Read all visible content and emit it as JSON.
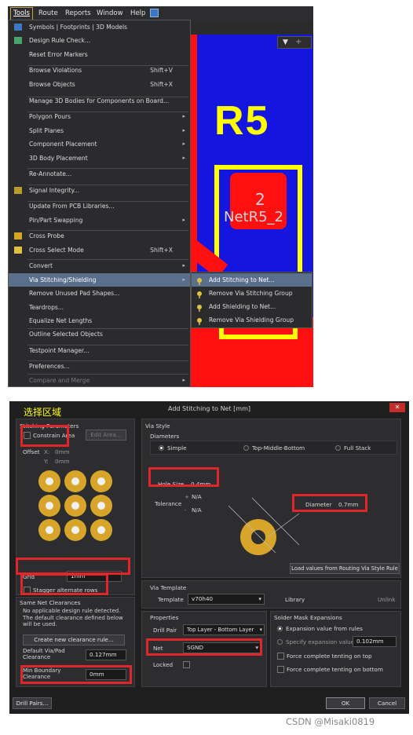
{
  "menubar": [
    "Tools",
    "Route",
    "Reports",
    "Window",
    "Help"
  ],
  "tools_menu": {
    "items": [
      {
        "label": "Symbols | Footprints | 3D Models",
        "shortcut": "",
        "arrow": false
      },
      {
        "label": "Design Rule Check...",
        "shortcut": "",
        "arrow": false
      },
      {
        "label": "Reset Error Markers",
        "shortcut": "",
        "arrow": false
      },
      {
        "label": "Browse Violations",
        "shortcut": "Shift+V",
        "arrow": false
      },
      {
        "label": "Browse Objects",
        "shortcut": "Shift+X",
        "arrow": false
      },
      {
        "label": "Manage 3D Bodies for Components on Board...",
        "shortcut": "",
        "arrow": false
      },
      {
        "label": "Polygon Pours",
        "shortcut": "",
        "arrow": true
      },
      {
        "label": "Split Planes",
        "shortcut": "",
        "arrow": true
      },
      {
        "label": "Component Placement",
        "shortcut": "",
        "arrow": true
      },
      {
        "label": "3D Body Placement",
        "shortcut": "",
        "arrow": true
      },
      {
        "label": "Re-Annotate...",
        "shortcut": "",
        "arrow": false
      },
      {
        "label": "Signal Integrity...",
        "shortcut": "",
        "arrow": false
      },
      {
        "label": "Update From PCB Libraries...",
        "shortcut": "",
        "arrow": false
      },
      {
        "label": "Pin/Part Swapping",
        "shortcut": "",
        "arrow": true
      },
      {
        "label": "Cross Probe",
        "shortcut": "",
        "arrow": false
      },
      {
        "label": "Cross Select Mode",
        "shortcut": "Shift+X",
        "arrow": false
      },
      {
        "label": "Convert",
        "shortcut": "",
        "arrow": true
      },
      {
        "label": "Via Stitching/Shielding",
        "shortcut": "",
        "arrow": true
      },
      {
        "label": "Remove Unused Pad Shapes...",
        "shortcut": "",
        "arrow": false
      },
      {
        "label": "Teardrops...",
        "shortcut": "",
        "arrow": false
      },
      {
        "label": "Equalize Net Lengths",
        "shortcut": "",
        "arrow": false
      },
      {
        "label": "Outline Selected Objects",
        "shortcut": "",
        "arrow": false
      },
      {
        "label": "Testpoint Manager...",
        "shortcut": "",
        "arrow": false
      },
      {
        "label": "Preferences...",
        "shortcut": "",
        "arrow": false
      },
      {
        "label": "Compare and Merge",
        "shortcut": "",
        "arrow": true
      }
    ]
  },
  "submenu": {
    "items": [
      "Add Stitching to Net...",
      "Remove Via Stitching Group",
      "Add Shielding to Net...",
      "Remove Via Shielding Group"
    ]
  },
  "pcb": {
    "designator": "R5",
    "pad_number": "2",
    "net_label": "NetR5_2"
  },
  "dialog": {
    "title": "Add Stitching to Net [mm]",
    "annotation": "选择区域",
    "stitching": {
      "header": "Stitching Parameters",
      "constrain_area": "Constrain Area",
      "edit_area": "Edit Area...",
      "offset_label": "Offset",
      "offset_x_label": "X:",
      "offset_x": "0mm",
      "offset_y_label": "Y:",
      "offset_y": "0mm",
      "grid_label": "Grid",
      "grid_value": "1mm",
      "stagger": "Stagger alternate rows"
    },
    "same_net": {
      "header": "Same Net Clearances",
      "note": "No applicable design rule detected. The default clearance defined below will be used.",
      "create_rule": "Create new clearance rule...",
      "default_via_label": "Default Via/Pad Clearance",
      "default_via_value": "0.127mm",
      "min_boundary_label": "Min Boundary Clearance",
      "min_boundary_value": "0mm"
    },
    "via_style": {
      "header": "Via Style",
      "diameters_label": "Diameters",
      "simple": "Simple",
      "tmb": "Top-Middle-Bottom",
      "full_stack": "Full Stack",
      "hole_size_label": "Hole Size",
      "hole_size_value": "0.4mm",
      "tolerance_label": "Tolerance",
      "tol_plus": "N/A",
      "tol_minus": "N/A",
      "diameter_label": "Diameter",
      "diameter_value": "0.7mm",
      "load_values": "Load values from Routing Via Style Rule"
    },
    "via_template": {
      "header": "Via Template",
      "template_label": "Template",
      "template_value": "v70h40",
      "library_label": "Library",
      "unlink": "Unlink"
    },
    "properties": {
      "header": "Properties",
      "drill_pair_label": "Drill Pair",
      "drill_pair_value": "Top Layer - Bottom Layer",
      "net_label": "Net",
      "net_value": "SGND",
      "locked_label": "Locked"
    },
    "solder_mask": {
      "header": "Solder Mask Expansions",
      "from_rules": "Expansion value from rules",
      "specify": "Specify expansion value",
      "specify_value": "0.102mm",
      "tent_top": "Force complete tenting on top",
      "tent_bottom": "Force complete tenting on bottom"
    },
    "buttons": {
      "drill_pairs": "Drill Pairs...",
      "ok": "OK",
      "cancel": "Cancel"
    }
  },
  "watermark": "CSDN @Misaki0819",
  "colors": {
    "highlight": "#5a6f8c",
    "annotation_red": "#e0262a",
    "via_gold": "#d7a52a",
    "pcb_blue": "#1515e0",
    "pcb_red": "#ff1010",
    "silk_yellow": "#ffff00"
  }
}
